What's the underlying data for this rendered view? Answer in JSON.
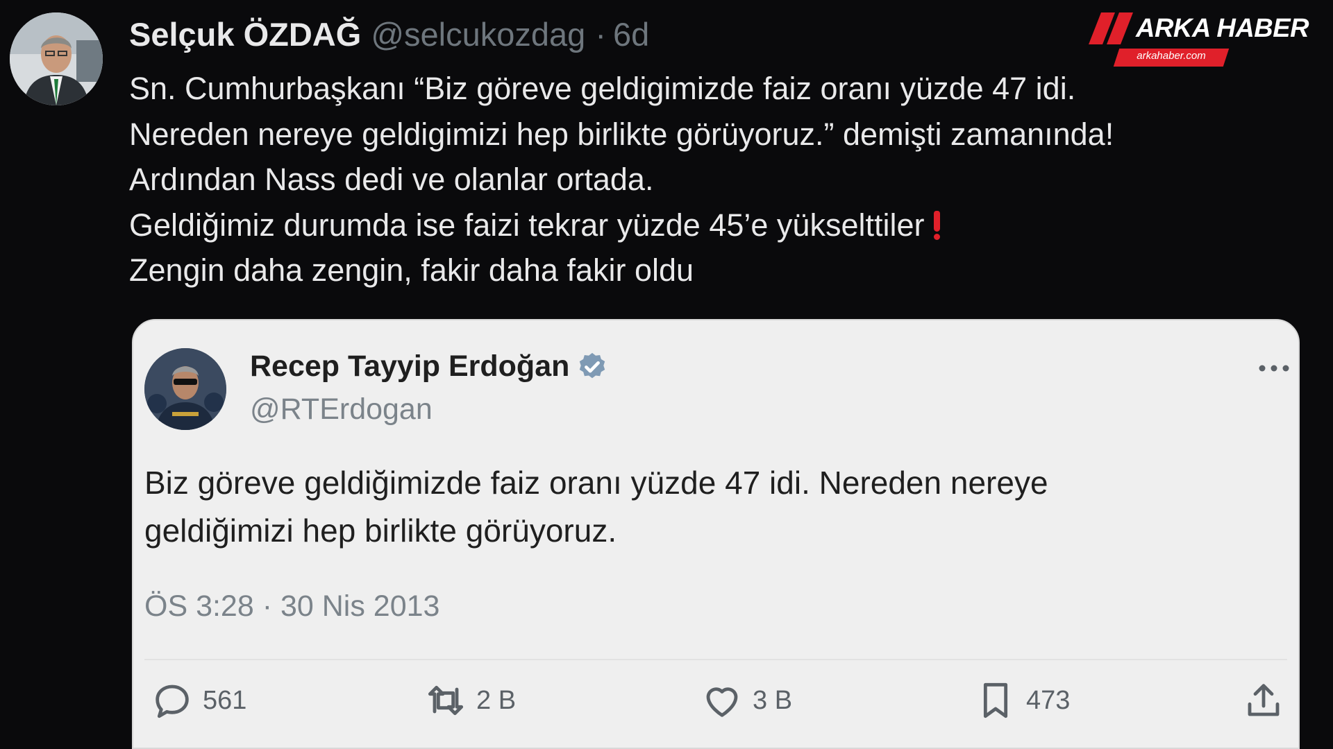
{
  "outer_tweet": {
    "author_name": "Selçuk ÖZDAĞ",
    "handle": "@selcukozdag",
    "separator": "·",
    "age": "6d",
    "lines": [
      "Sn. Cumhurbaşkanı “Biz göreve geldigimizde faiz oranı yüzde 47 idi.",
      "Nereden nereye geldigimizi hep birlikte görüyoruz.” demişti zamanında!",
      "Ardından Nass dedi ve olanlar ortada.",
      "Geldiğimiz durumda ise faizi tekrar yüzde 45’e yükselttiler",
      "Zengin daha zengin, fakir daha fakir oldu"
    ],
    "emoji_icon": "red-exclamation-icon"
  },
  "watermark": {
    "brand": "ARKA HABER",
    "url": "arkahaber.com",
    "accent_color": "#e0202a"
  },
  "quoted_tweet": {
    "author_name": "Recep Tayyip Erdoğan",
    "verified_icon": "verified-badge-icon",
    "handle": "@RTErdogan",
    "lines": [
      "Biz göreve geldiğimizde faiz oranı yüzde 47 idi. Nereden nereye",
      "geldiğimizi hep birlikte görüyoruz."
    ],
    "timestamp": "ÖS 3:28 · 30 Nis 2013",
    "actions": {
      "replies": "561",
      "retweets": "2 B",
      "likes": "3 B",
      "bookmarks": "473"
    }
  }
}
